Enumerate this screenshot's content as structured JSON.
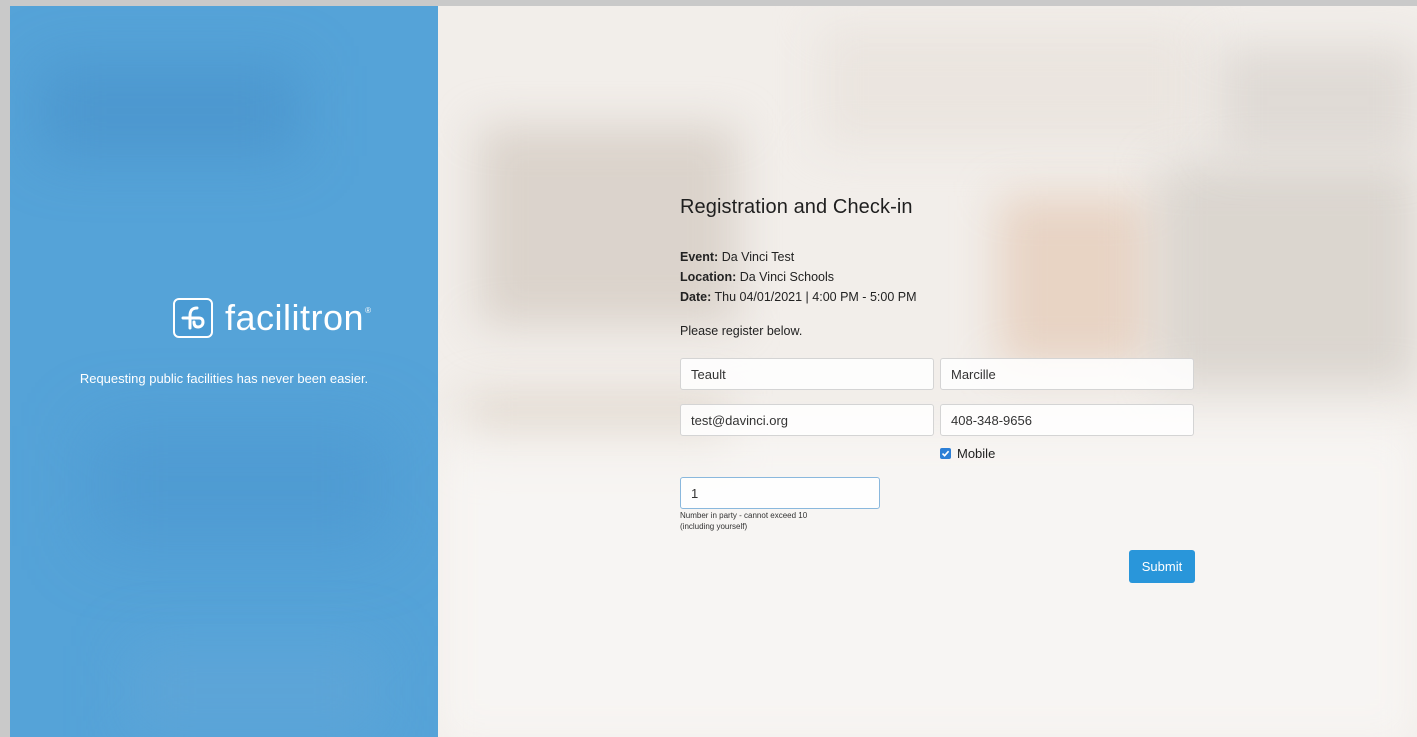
{
  "brand": {
    "name": "facilitron",
    "registered_mark": "®",
    "tagline": "Requesting public facilities has never been easier."
  },
  "form": {
    "title": "Registration and Check-in",
    "event": {
      "label": "Event:",
      "value": "Da Vinci Test"
    },
    "location": {
      "label": "Location:",
      "value": "Da Vinci Schools"
    },
    "date": {
      "label": "Date:",
      "value": "Thu 04/01/2021 | 4:00 PM - 5:00 PM"
    },
    "intro": "Please register below.",
    "first_name": "Teault",
    "last_name": "Marcille",
    "email": "test@davinci.org",
    "phone": "408-348-9656",
    "mobile": {
      "label": "Mobile",
      "checked": true
    },
    "party_size": "1",
    "party_hint_line1": "Number in party - cannot exceed 10",
    "party_hint_line2": "(including yourself)",
    "submit_label": "Submit"
  },
  "colors": {
    "brand_blue": "#55a3d8",
    "button_blue": "#2996da"
  }
}
